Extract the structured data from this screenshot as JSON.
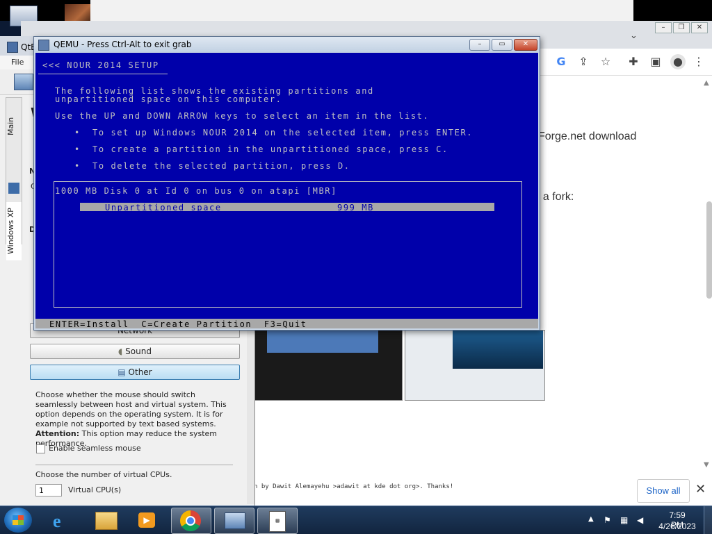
{
  "chrome": {
    "page_text_1": "Forge.net download",
    "page_text_2": "t a fork:",
    "footer_text": "n by Dawit Alemayehu >adawit at kde dot org>. Thanks!",
    "show_all_label": "Show all"
  },
  "qtemu": {
    "title": "QtE",
    "menu_file": "File",
    "tabs": [
      "Main",
      "Windows XP"
    ],
    "frag_w": "W",
    "frag_n": "N",
    "frag_c": "C",
    "frag_d": "D",
    "buttons": {
      "network": "Network",
      "sound": "Sound",
      "other": "Other"
    },
    "description": "Choose whether the mouse should switch seamlessly between host and virtual system. This option depends on the operating system. It is for example not supported by text based systems.",
    "attention_label": "Attention:",
    "attention_text": "This option may reduce the system performance.",
    "seamless_label": "Enable seamless mouse",
    "cpu_desc": "Choose the number of virtual CPUs.",
    "cpu_value": "1",
    "cpu_label": "Virtual CPU(s)"
  },
  "qemu": {
    "title": "QEMU - Press Ctrl-Alt to exit grab",
    "setup_header": "<<< NOUR 2014 SETUP",
    "intro_line1": "The following list shows the existing partitions and",
    "intro_line2": "unpartitioned space on this computer.",
    "instructions": "Use the UP and DOWN ARROW keys to select an item in the list.",
    "bullet": "•",
    "bullets": [
      "To set up Windows NOUR 2014 on the selected item, press ENTER.",
      "To create a partition in the unpartitioned space, press C.",
      "To delete the selected partition, press D."
    ],
    "disk_line": "1000 MB Disk 0 at Id 0 on bus 0 on atapi [MBR]",
    "partition_name": "Unpartitioned space",
    "partition_size": "999 MB",
    "status_bar": "ENTER=Install  C=Create Partition  F3=Quit"
  },
  "taskbar": {
    "time": "7:59 PM",
    "date": "4/26/2023"
  },
  "colors": {
    "setup_bg": "#0000aa",
    "setup_fg": "#c0c0c0",
    "highlight_bg": "#a8a8a8",
    "status_bar_bg": "#a8a8a8"
  }
}
